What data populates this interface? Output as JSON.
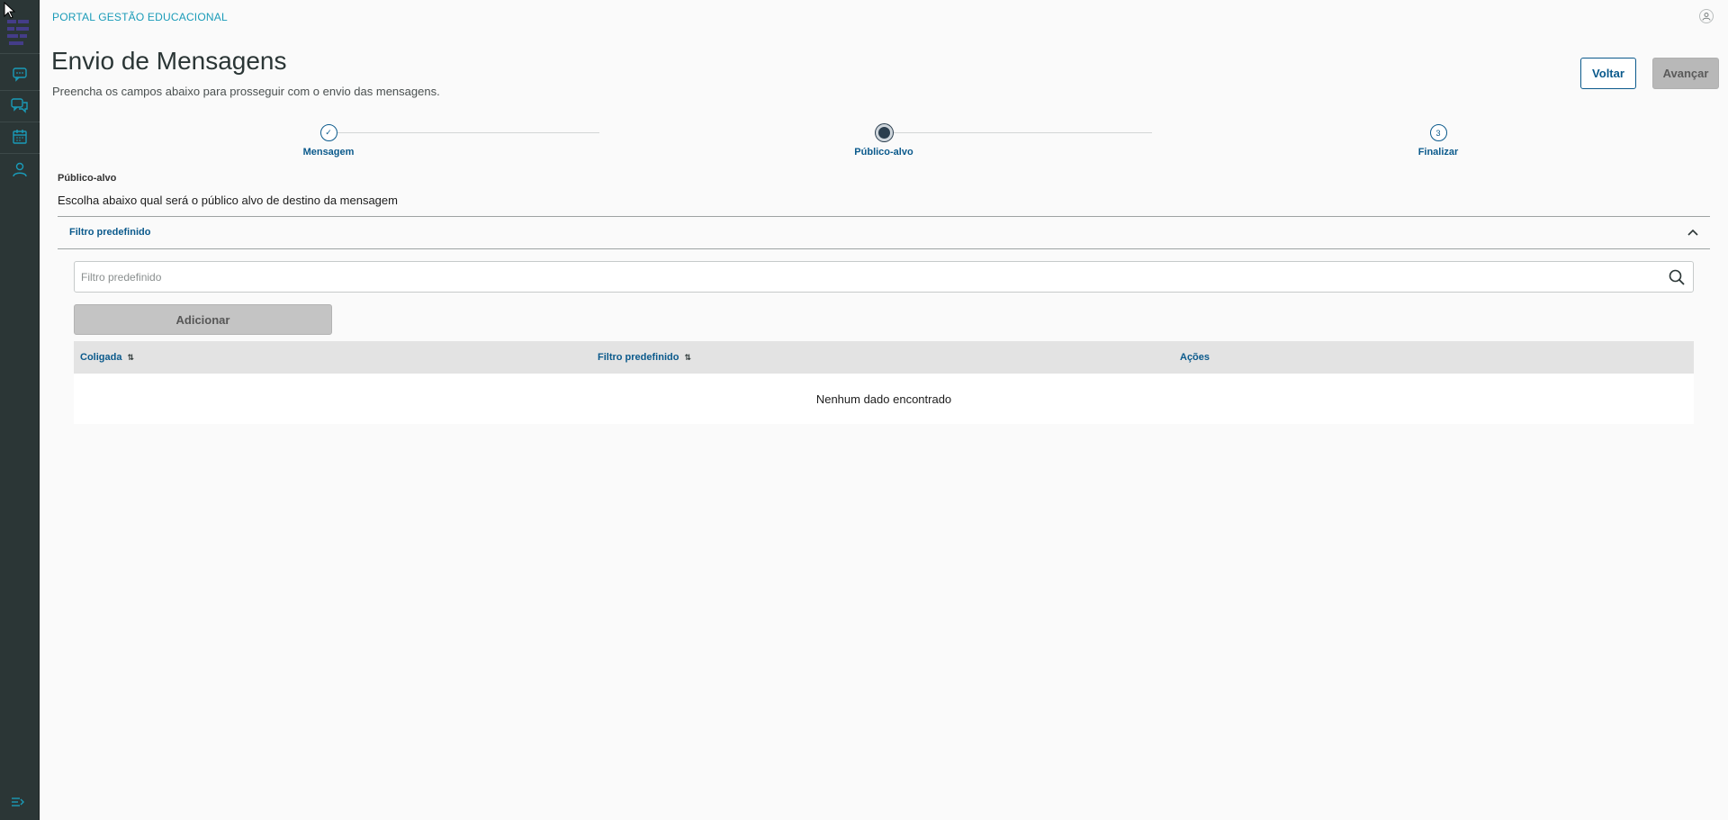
{
  "header": {
    "portal_name": "PORTAL GESTÃO EDUCACIONAL",
    "user_icon": "user-icon"
  },
  "sidebar": {
    "items": [
      {
        "icon": "chat-icon"
      },
      {
        "icon": "conversations-icon"
      },
      {
        "icon": "calendar-icon"
      },
      {
        "icon": "person-icon"
      }
    ],
    "toggle_icon": "menu-collapse-icon",
    "accent": "#1a9bb8"
  },
  "page": {
    "title": "Envio de Mensagens",
    "subtitle": "Preencha os campos abaixo para prosseguir com o envio das mensagens.",
    "back_label": "Voltar",
    "next_label": "Avançar"
  },
  "stepper": {
    "steps": [
      {
        "label": "Mensagem",
        "state": "done",
        "marker": "✓"
      },
      {
        "label": "Público-alvo",
        "state": "active",
        "marker": ""
      },
      {
        "label": "Finalizar",
        "state": "pending",
        "marker": "3"
      }
    ]
  },
  "section": {
    "label": "Público-alvo",
    "description": "Escolha abaixo qual será o público alvo de destino da mensagem"
  },
  "accordion": {
    "title": "Filtro predefinido",
    "expanded": true
  },
  "filter": {
    "placeholder": "Filtro predefinido",
    "value": "",
    "add_label": "Adicionar"
  },
  "table": {
    "columns": [
      {
        "label": "Coligada",
        "sortable": true
      },
      {
        "label": "Filtro predefinido",
        "sortable": true
      },
      {
        "label": "Ações",
        "sortable": false
      }
    ],
    "sort_glyph": "⇅",
    "empty_text": "Nenhum dado encontrado"
  },
  "colors": {
    "sidebar_bg": "#2b3636",
    "primary": "#0b5a8c",
    "disabled_button": "#c4c4c4"
  }
}
